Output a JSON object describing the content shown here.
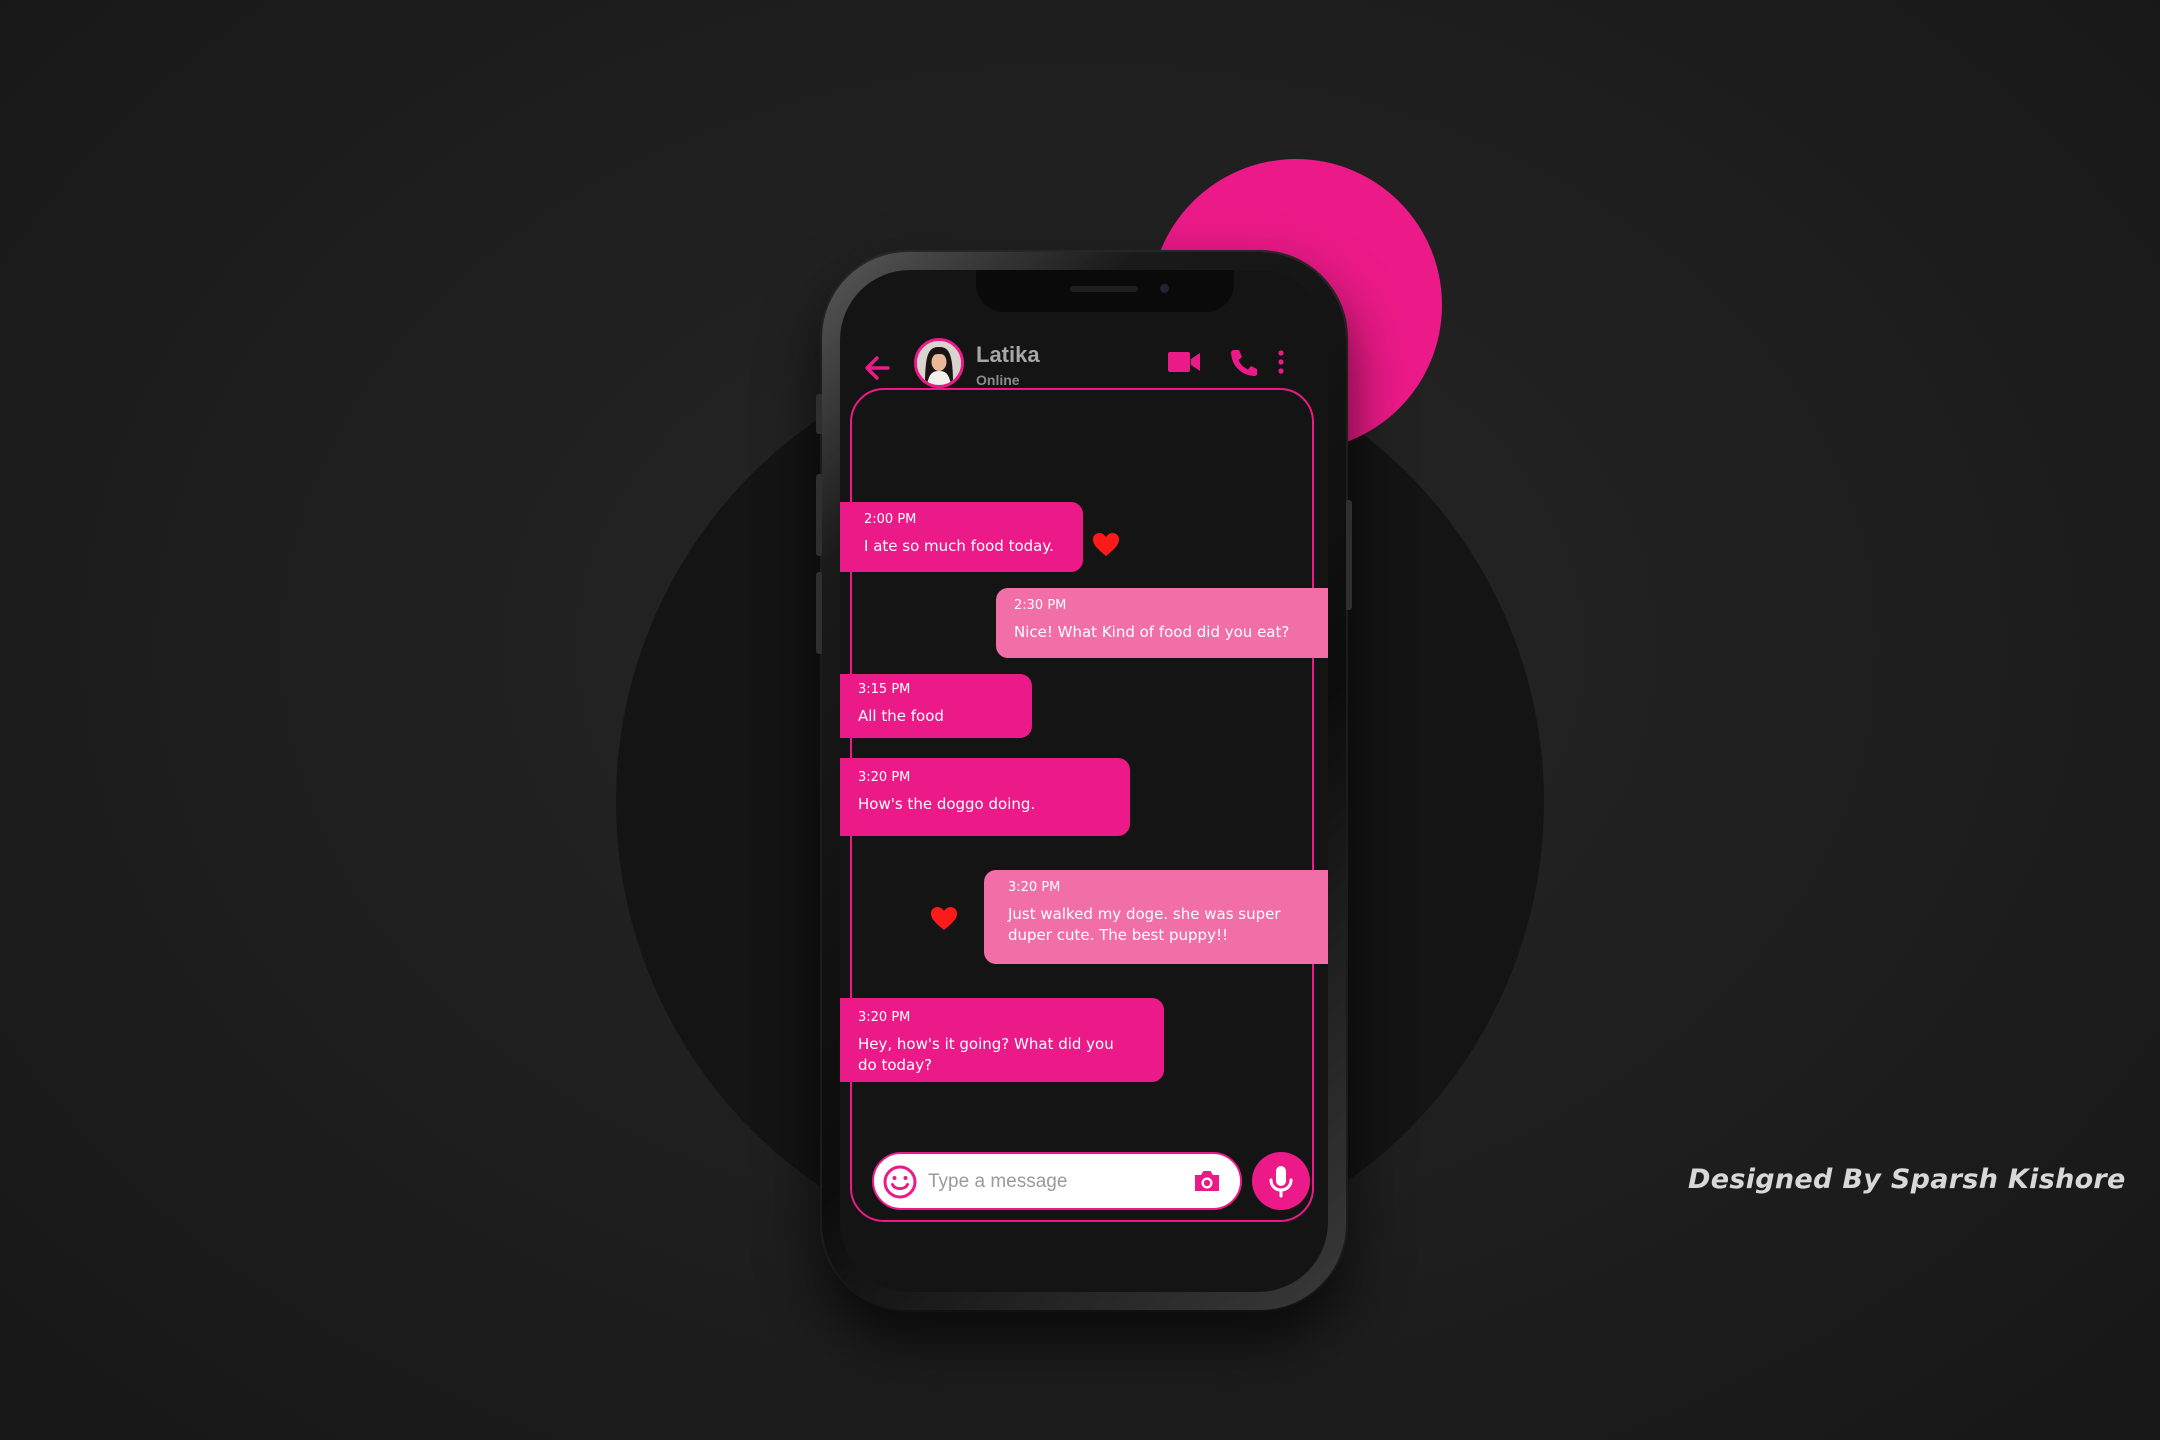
{
  "colors": {
    "accent": "#ec1a88",
    "accent_light": "#f26ea6",
    "heart": "#ff1a1a",
    "background": "#1f1f1f",
    "screen": "#141414"
  },
  "header": {
    "contact_name": "Latika",
    "status": "Online",
    "icons": [
      "back-arrow-icon",
      "avatar",
      "video-camera-icon",
      "phone-icon",
      "more-vertical-icon"
    ]
  },
  "messages": [
    {
      "direction": "incoming",
      "time": "2:00 PM",
      "text": "I ate so much food today.",
      "liked": true
    },
    {
      "direction": "outgoing",
      "time": "2:30 PM",
      "text": "Nice! What Kind of food did you eat?",
      "liked": false
    },
    {
      "direction": "incoming",
      "time": "3:15 PM",
      "text": "All the food",
      "liked": false
    },
    {
      "direction": "incoming",
      "time": "3:20 PM",
      "text": "How's the doggo doing.",
      "liked": false
    },
    {
      "direction": "outgoing",
      "time": "3:20 PM",
      "text": "Just walked my doge. she was super duper cute. The best puppy!!",
      "liked": true
    },
    {
      "direction": "incoming",
      "time": "3:20 PM",
      "text": "Hey, how's it going? What did you do today?",
      "liked": false
    }
  ],
  "composer": {
    "placeholder": "Type a message",
    "value": ""
  },
  "credit": "Designed By Sparsh  Kishore"
}
